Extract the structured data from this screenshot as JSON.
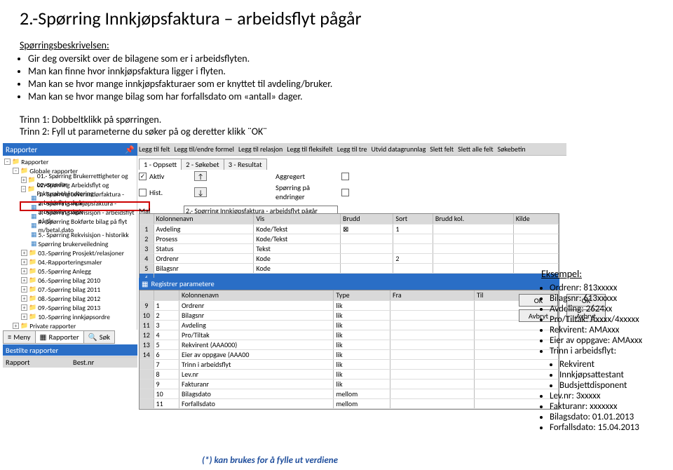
{
  "title": "2.-Spørring Innkjøpsfaktura – arbeidsflyt pågår",
  "desc": {
    "heading": "Spørringsbeskrivelsen:",
    "bullets": [
      "Gir deg oversikt over de bilagene som er i arbeidsflyten.",
      "Man kan finne hvor innkjøpsfaktura ligger i flyten.",
      "Man kan se hvor mange innkjøpsfakturaer som er knyttet til avdeling/bruker.",
      "Man kan se hvor mange bilag som har forfallsdato om «antall» dager."
    ]
  },
  "steps": {
    "s1": "Trinn 1: Dobbeltklikk på spørringen.",
    "s2": "Trinn 2: Fyll ut parameterne du søker på og deretter klikk ¨OK¨"
  },
  "rapporter_label": "Rapporter",
  "toolbar": [
    "Legg til felt",
    "Legg til/endre formel",
    "Legg til relasjon",
    "Legg til fleksifelt",
    "Legg til tre",
    "Utvid datagrunnlag",
    "Slett felt",
    "Slett alle felt",
    "Søkebetin"
  ],
  "tree": {
    "root": "Rapporter",
    "global": "Globale rapporter",
    "items": [
      "01.- Spørring Brukerrettigheter og Leverandør",
      "02.-Spørring Arbeidsflyt og Fakturabehåndtering",
      "1.- Spørring Leverandørfaktura - arbeidsflyt pågår",
      "2.- Spørring Innkjøpsfaktura - arbeidsflyt pågår",
      "3.- Spørring Rekvisisjon - arbeidsflyt pågår",
      "4.- Spørring Bokførte bilag på flyt m/betal.dato",
      "5.- Spørring Rekvisisjon - historikk",
      "Spørring brukerveiledning",
      "03.-Spørring Prosjekt/relasjoner",
      "04.-Rapporteringsmaler",
      "05.-Spørring Anlegg",
      "06.-Spørring bilag 2010",
      "07.-Spørring bilag 2011",
      "08.-Spørring bilag 2012",
      "09.-Spørring bilag 2013",
      "10.-Spørring innkjøpsordre",
      "Private rapporter"
    ]
  },
  "tabs": {
    "t1": "1 - Oppsett",
    "t2": "2 - Søkebet",
    "t3": "3 - Resultat"
  },
  "form": {
    "aktiv": "Aktiv",
    "hist": "Hist.",
    "aggregert": "Aggregert",
    "sporring": "Spørring på endringer",
    "mal_label": "Mal",
    "mal_value": "2.- Spørring Innkjøpsfaktura - arbeidsflyt pågår"
  },
  "grid1": {
    "headers": [
      "Kolonnenavn",
      "Vis",
      "Brudd",
      "Sort",
      "Brudd kol.",
      "Kilde"
    ],
    "rows": [
      {
        "n": "1",
        "c": [
          "Avdeling",
          "Kode/Tekst",
          "⊠",
          "1",
          "",
          ""
        ]
      },
      {
        "n": "2",
        "c": [
          "Prosess",
          "Kode/Tekst",
          "",
          "",
          "",
          ""
        ]
      },
      {
        "n": "3",
        "c": [
          "Status",
          "Tekst",
          "",
          "",
          "",
          ""
        ]
      },
      {
        "n": "4",
        "c": [
          "Ordrenr",
          "Kode",
          "",
          "2",
          "",
          ""
        ]
      },
      {
        "n": "5",
        "c": [
          "Bilagsnr",
          "Kode",
          "",
          "",
          "",
          ""
        ]
      }
    ],
    "sel": "6"
  },
  "param_header": "Registrer parametere",
  "grid2": {
    "headers": [
      "Kolonnenavn",
      "Type",
      "Fra",
      "Til"
    ],
    "rows": [
      {
        "n": "9",
        "c": [
          "1",
          "Ordrenr",
          "lik",
          ""
        ]
      },
      {
        "n": "10",
        "c": [
          "2",
          "Bilagsnr",
          "lik",
          ""
        ]
      },
      {
        "n": "11",
        "c": [
          "3",
          "Avdeling",
          "lik",
          ""
        ]
      },
      {
        "n": "12",
        "c": [
          "4",
          "Pro/Tiltak",
          "lik",
          ""
        ]
      },
      {
        "n": "13",
        "c": [
          "5",
          "Rekvirent (AAA000)",
          "lik",
          ""
        ]
      },
      {
        "n": "14",
        "c": [
          "6",
          "Eier av oppgave (AAA00",
          "lik",
          ""
        ]
      },
      {
        "n": "",
        "c": [
          "7",
          "Trinn i arbeidsflyt",
          "lik",
          ""
        ]
      },
      {
        "n": "",
        "c": [
          "8",
          "Lev.nr",
          "lik",
          ""
        ]
      },
      {
        "n": "",
        "c": [
          "9",
          "Fakturanr",
          "lik",
          ""
        ]
      },
      {
        "n": "",
        "c": [
          "10",
          "Bilagsdato",
          "mellom",
          ""
        ]
      },
      {
        "n": "",
        "c": [
          "11",
          "Forfallsdato",
          "mellom",
          ""
        ]
      }
    ]
  },
  "buttons": {
    "ok": "OK",
    "avbryt": "Avbryt"
  },
  "bottom_tabs": {
    "meny": "Meny",
    "rapporter": "Rapporter",
    "sok": "Søk"
  },
  "bestilte": "Bestilte rapporter",
  "bestilte_cols": {
    "a": "Rapport",
    "b": "Best.nr"
  },
  "example": {
    "title": "Eksempel:",
    "items": [
      "Ordrenr: 813xxxxx",
      "Bilagsnr: 613xxxxx",
      "Avdeling: 2624xx",
      "Pro/Tiltak: Axxxx/4xxxxx",
      "Rekvirent: AMAxxx",
      "Eier av oppgave: AMAxxx"
    ],
    "trinn_label": "Trinn i arbeidsflyt:",
    "trinn_items": [
      "Rekvirent",
      "Innkjøpsattestant",
      "Budsjettdisponent"
    ],
    "tail": [
      "Lev.nr: 3xxxxx",
      "Fakturanr: xxxxxxx",
      "Bilagsdato: 01.01.2013",
      "Forfallsdato: 15.04.2013"
    ]
  },
  "footnote": "(*) kan brukes for å fylle ut  verdiene"
}
